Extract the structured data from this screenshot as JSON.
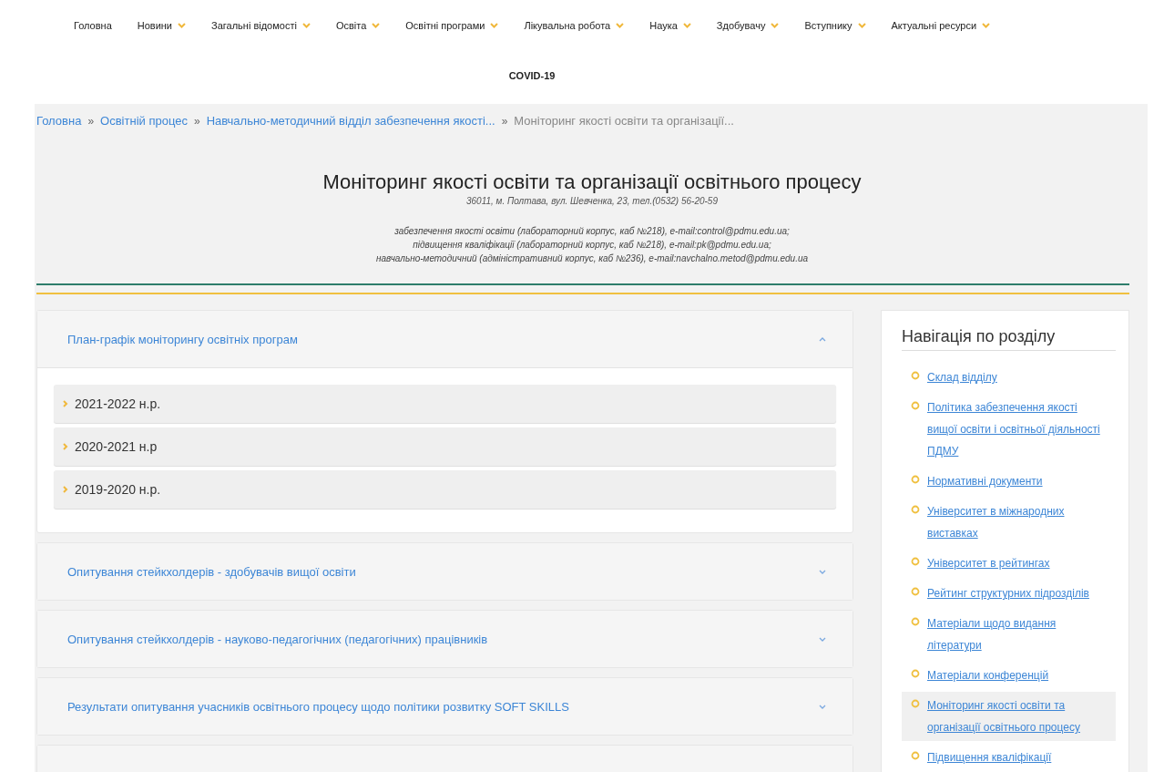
{
  "menu": [
    {
      "label": "Головна",
      "has_dropdown": false
    },
    {
      "label": "Новини",
      "has_dropdown": true
    },
    {
      "label": "Загальні відомості",
      "has_dropdown": true
    },
    {
      "label": "Освіта",
      "has_dropdown": true
    },
    {
      "label": "Освітні програми",
      "has_dropdown": true
    },
    {
      "label": "Лікувальна робота",
      "has_dropdown": true
    },
    {
      "label": "Наука",
      "has_dropdown": true
    },
    {
      "label": "Здобувачу",
      "has_dropdown": true
    },
    {
      "label": "Вступнику",
      "has_dropdown": true
    },
    {
      "label": "Актуальні ресурси",
      "has_dropdown": true
    },
    {
      "label": "COVID-19",
      "has_dropdown": false,
      "bold": true
    }
  ],
  "breadcrumb": [
    {
      "label": "Головна",
      "link": true
    },
    {
      "label": "Освітній процес",
      "link": true
    },
    {
      "label": "Навчально-методичний відділ забезпечення якості...",
      "link": true
    },
    {
      "label": "Моніторинг якості освіти та організації...",
      "link": false
    }
  ],
  "breadcrumb_separator": "»",
  "header": {
    "title": "Моніторинг якості освіти та організації освітнього процесу",
    "address": "36011,  м. Полтава, вул. Шевченка, 23,  тел.(0532) 56-20-59",
    "contacts": [
      "забезпечення якості освіти (лабораторний корпус, каб №218), e-mail:control@pdmu.edu.ua;",
      "підвищення кваліфікації (лабораторний корпус, каб №218), e-mail:pk@pdmu.edu.ua;",
      "навчально-методичний  (адміністративний корпус, каб №236), e-mail:navchalno.metod@pdmu.edu.ua"
    ]
  },
  "accordion": [
    {
      "title": "План-графік моніторингу освітніх програм",
      "expanded": true,
      "children": [
        {
          "label": "2021-2022 н.р."
        },
        {
          "label": "2020-2021 н.р"
        },
        {
          "label": "2019-2020 н.р."
        }
      ]
    },
    {
      "title": "Опитування стейкхолдерів - здобувачів вищої освіти",
      "expanded": false
    },
    {
      "title": "Опитування стейкхолдерів - науково-педагогічних (педагогічних) працівників",
      "expanded": false
    },
    {
      "title": "Результати опитування учасників освітнього процесу щодо політики розвитку SOFT SKILLS",
      "expanded": false
    },
    {
      "expanded": false
    }
  ],
  "sidebar": {
    "title": "Навігація по розділу",
    "items": [
      {
        "label": "Склад відділу",
        "selected": false
      },
      {
        "label": "Політика забезпечення якості вищої освіти і освітньої діяльності ПДМУ",
        "selected": false
      },
      {
        "label": "Нормативні документи",
        "selected": false
      },
      {
        "label": "Університет в міжнародних виставках",
        "selected": false
      },
      {
        "label": "Університет в рейтингах",
        "selected": false
      },
      {
        "label": "Рейтинг структурних підрозділів",
        "selected": false
      },
      {
        "label": "Матеріали щодо видання літератури",
        "selected": false
      },
      {
        "label": "Матеріали конференцій",
        "selected": false
      },
      {
        "label": "Моніторинг якості освіти та організації освітнього процесу",
        "selected": true
      },
      {
        "label": "Підвищення кваліфікації",
        "selected": false
      }
    ]
  }
}
